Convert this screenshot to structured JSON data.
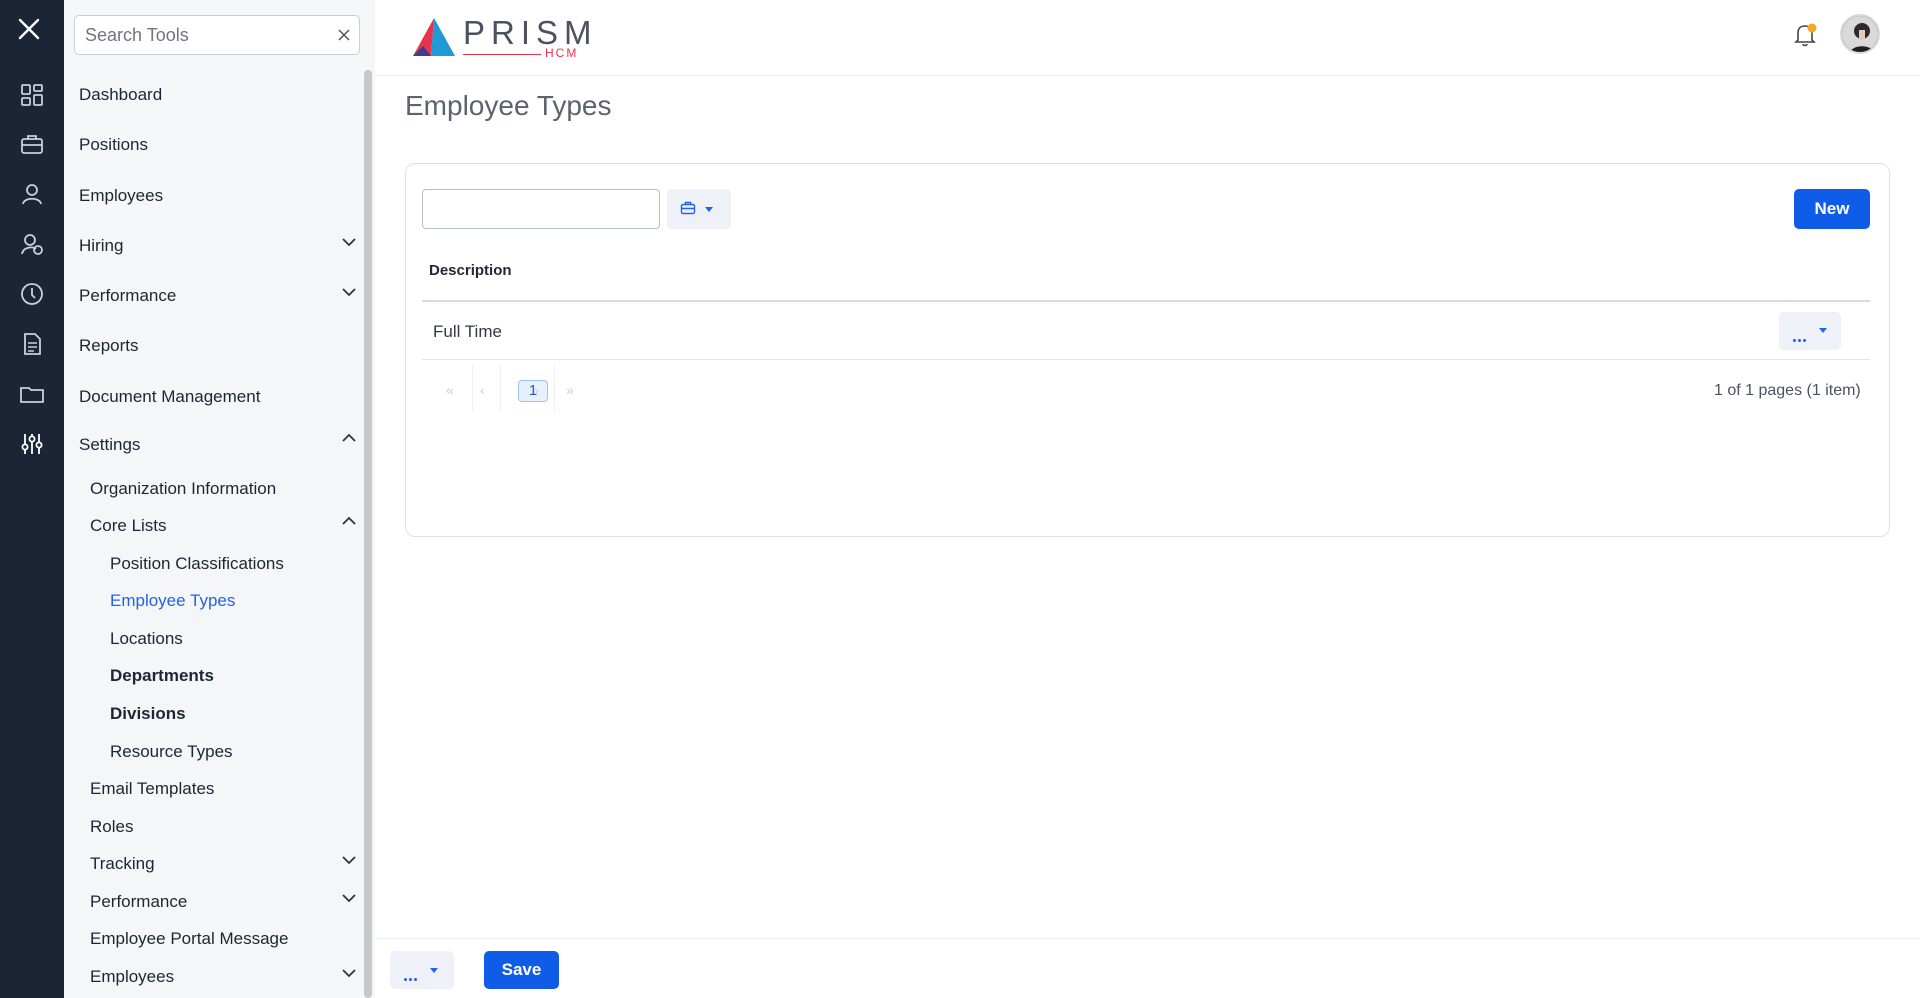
{
  "rail": {
    "icons": [
      "close-icon",
      "dashboard-icon",
      "briefcase-icon",
      "person-icon",
      "hiring-icon",
      "performance-icon",
      "reports-icon",
      "folder-icon",
      "settings-sliders-icon"
    ]
  },
  "sidebar": {
    "search_placeholder": "Search Tools",
    "items": {
      "dashboard": "Dashboard",
      "positions": "Positions",
      "employees": "Employees",
      "hiring": "Hiring",
      "performance": "Performance",
      "reports": "Reports",
      "document_management": "Document Management",
      "settings": "Settings"
    },
    "settings_children": {
      "organization_information": "Organization Information",
      "core_lists": "Core Lists",
      "email_templates": "Email Templates",
      "roles": "Roles",
      "tracking": "Tracking",
      "performance": "Performance",
      "employee_portal_message": "Employee Portal Message",
      "employees": "Employees"
    },
    "core_lists_children": {
      "position_classifications": "Position Classifications",
      "employee_types": "Employee Types",
      "locations": "Locations",
      "departments": "Departments",
      "divisions": "Divisions",
      "resource_types": "Resource Types"
    },
    "active_item": "Employee Types"
  },
  "header": {
    "logo_word": "PRISM",
    "logo_sub": "HCM",
    "notification_dot_color": "#f5a623"
  },
  "main": {
    "page_title": "Employee Types",
    "filter_value": "",
    "new_label": "New",
    "columns": [
      "Description"
    ],
    "rows": [
      {
        "description": "Full Time"
      }
    ],
    "pager": {
      "first": "«",
      "prev": "‹",
      "current": "1",
      "next": "›",
      "last": "»",
      "info": "1 of 1 pages (1 item)"
    }
  },
  "footer": {
    "save_label": "Save"
  },
  "colors": {
    "rail_bg": "#1b2536",
    "sidebar_bg": "#f5f6f8",
    "accent": "#0f5ce8",
    "active_link": "#2163e8",
    "brand_red": "#e8334c"
  }
}
